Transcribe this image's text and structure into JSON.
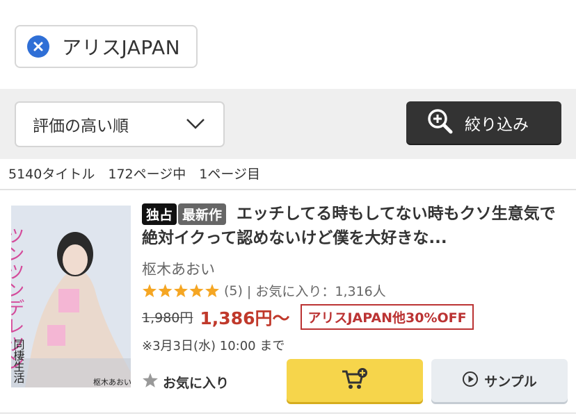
{
  "search_chip": {
    "label": "アリスJAPAN",
    "close_icon": "close-circle-icon"
  },
  "toolbar": {
    "sort_label": "評価の高い順",
    "filter_label": "絞り込み"
  },
  "results": {
    "count_text": "5140タイトル　172ページ中　1ページ目"
  },
  "product": {
    "badges": [
      "独占",
      "最新作"
    ],
    "title": "エッチしてる時もしてない時もクソ生意気で絶対イクって認めないけど僕を大好きな...",
    "actress": "枢木あおい",
    "rating": {
      "stars": 5,
      "count_text": "(5)",
      "favorites_text": "| お気に入り：1,316人"
    },
    "old_price": "1,980円",
    "new_price": "1,386円〜",
    "sale_text": "アリスJAPAN他30%OFF",
    "date_text": "※3月3日(水) 10:00 まで",
    "fav_label": "お気に入り",
    "sample_label": "サンプル",
    "cover_texts": {
      "vertical_title": "ツンツンデレツン",
      "subtitle": "同棲生活",
      "actress_small": "枢木あおい"
    }
  },
  "colors": {
    "accent_blue": "#2f6fd6",
    "price_red": "#c0392b",
    "cart_yellow": "#f6d54b",
    "star_orange": "#f5a623"
  }
}
